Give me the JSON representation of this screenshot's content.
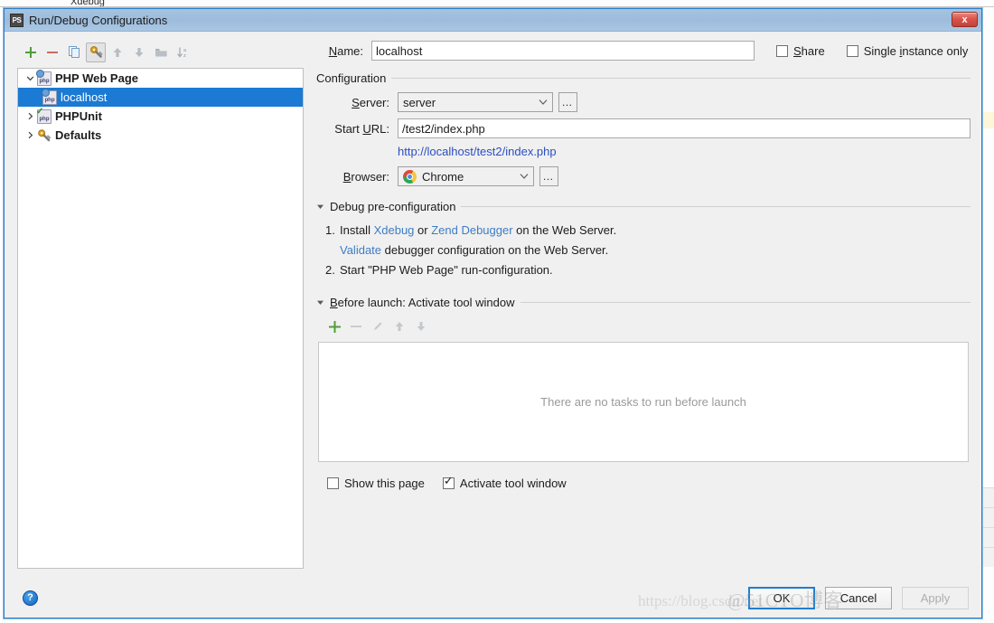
{
  "window": {
    "title": "Run/Debug Configurations",
    "app_icon": "phpstorm-icon",
    "app_icon_text": "PS",
    "close_label": "x"
  },
  "tree_toolbar": {
    "buttons": [
      {
        "name": "add-configuration-button",
        "icon": "plus-icon",
        "state": "enabled"
      },
      {
        "name": "remove-configuration-button",
        "icon": "minus-icon",
        "state": "enabled"
      },
      {
        "name": "copy-configuration-button",
        "icon": "copy-icon",
        "state": "enabled"
      },
      {
        "name": "edit-defaults-button",
        "icon": "wrench-icon",
        "state": "active"
      },
      {
        "name": "move-up-button",
        "icon": "arrow-up-icon",
        "state": "disabled"
      },
      {
        "name": "move-down-button",
        "icon": "arrow-down-icon",
        "state": "disabled"
      },
      {
        "name": "move-into-folder-button",
        "icon": "folder-icon",
        "state": "disabled"
      },
      {
        "name": "sort-alphabetically-button",
        "icon": "sort-az-icon",
        "state": "disabled"
      }
    ]
  },
  "tree": {
    "items": [
      {
        "label": "PHP Web Page",
        "icon": "php-web-page-icon",
        "expanded": true,
        "bold": true,
        "selected": false,
        "child": false,
        "twisty": "⌄"
      },
      {
        "label": "localhost",
        "icon": "php-web-page-icon",
        "expanded": false,
        "bold": false,
        "selected": true,
        "child": true,
        "twisty": ""
      },
      {
        "label": "PHPUnit",
        "icon": "phpunit-icon",
        "expanded": false,
        "bold": true,
        "selected": false,
        "child": false,
        "twisty": "›"
      },
      {
        "label": "Defaults",
        "icon": "wrench-icon",
        "expanded": false,
        "bold": true,
        "selected": false,
        "child": false,
        "twisty": "›"
      }
    ]
  },
  "name_row": {
    "label": "Name:",
    "label_mnemonic": "N",
    "label_rest": "ame:",
    "value": "localhost",
    "placeholder": "",
    "share": {
      "label": "Share",
      "mnemonic": "S",
      "rest": "hare",
      "checked": false
    },
    "single_instance": {
      "label": "Single instance only",
      "pre": "Single ",
      "mnemonic": "i",
      "rest": "nstance only",
      "checked": false
    }
  },
  "configuration": {
    "title": "Configuration",
    "server": {
      "label": "Server:",
      "mnemonic": "S",
      "rest": "erver:",
      "value": "server",
      "browse_label": "...",
      "options": [
        "server"
      ]
    },
    "start_url": {
      "label_pre": "Start ",
      "mnemonic": "U",
      "rest": "RL:",
      "value": "/test2/index.php",
      "placeholder": "",
      "preview_url": "http://localhost/test2/index.php"
    },
    "browser": {
      "label": "Browser:",
      "mnemonic": "B",
      "rest": "rowser:",
      "value": "Chrome",
      "icon": "chrome-icon",
      "browse_label": "...",
      "options": [
        "Chrome"
      ]
    }
  },
  "debug_preconfig": {
    "title": "Debug pre-configuration",
    "expanded": true,
    "step1": {
      "num": "1.",
      "text_a": "Install ",
      "link_xdebug": "Xdebug",
      "text_b": " or ",
      "link_zend": "Zend Debugger",
      "text_c": " on the Web Server."
    },
    "step1_sub": {
      "link_validate": "Validate",
      "text": " debugger configuration on the Web Server."
    },
    "step2": {
      "num": "2.",
      "text": "Start \"PHP Web Page\" run-configuration."
    }
  },
  "before_launch": {
    "title": "Before launch: Activate tool window",
    "mnemonic": "B",
    "rest": "efore launch: Activate tool window",
    "expanded": true,
    "toolbar": [
      {
        "name": "add-task-button",
        "icon": "plus-icon",
        "state": "enabled"
      },
      {
        "name": "remove-task-button",
        "icon": "minus-icon",
        "state": "disabled"
      },
      {
        "name": "edit-task-button",
        "icon": "pencil-icon",
        "state": "disabled"
      },
      {
        "name": "task-move-up-button",
        "icon": "arrow-up-icon",
        "state": "disabled"
      },
      {
        "name": "task-move-down-button",
        "icon": "arrow-down-icon",
        "state": "disabled"
      }
    ],
    "empty_text": "There are no tasks to run before launch",
    "show_this_page": {
      "label": "Show this page",
      "checked": false
    },
    "activate_tool_window": {
      "label": "Activate tool window",
      "checked": true
    }
  },
  "footer": {
    "help_label": "?",
    "ok_label": "OK",
    "cancel_label": "Cancel",
    "apply_label": "Apply",
    "apply_enabled": false
  },
  "watermark": {
    "text_right": "@51CTO博客",
    "text_left": "https://blog.csdn.net"
  },
  "colors": {
    "accent": "#1a7ad4",
    "link": "#2b4ec2",
    "link_blue": "#3d7dc4",
    "titlebar": "#a6c3e0",
    "close_red": "#d9534a",
    "plus_green": "#5aa832",
    "minus_red": "#d06a63"
  }
}
